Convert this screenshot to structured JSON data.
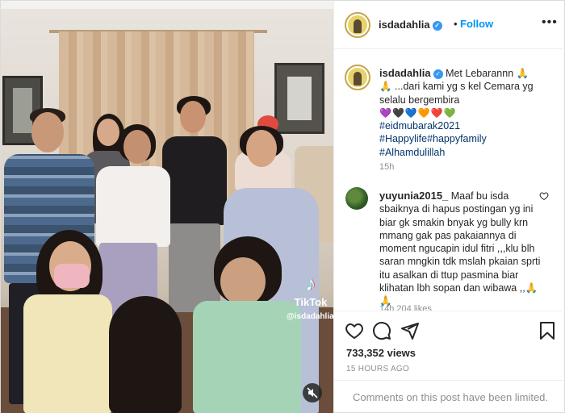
{
  "media": {
    "watermark_brand": "TikTok",
    "watermark_handle": "@isdadahlia"
  },
  "header": {
    "username": "isdadahlia",
    "separator": "•",
    "follow_label": "Follow",
    "more_label": "•••"
  },
  "caption": {
    "username": "isdadahlia",
    "text_line1": "Met Lebarannn 🙏",
    "text_line2": "🙏 ...dari kami yg s kel Cemara yg selalu bergembira",
    "hearts": "💜🖤💙🧡❤️💚",
    "hashtags": [
      "#eidmubarak2021",
      "#Happylife#happyfamily",
      "#Alhamdulillah"
    ],
    "time": "15h"
  },
  "comment": {
    "username": "yuyunia2015_",
    "text": "Maaf bu isda sbaiknya di hapus postingan yg ini biar gk smakin bnyak yg bully krn mmang gak pas pakaiannya di moment ngucapin idul fitri ,,,klu blh saran mngkin tdk mslah pkaian sprti itu asalkan di ttup pasmina biar klihatan lbh sopan dan wibawa ,,🙏🙏",
    "meta": "14h  204 likes"
  },
  "actions": {
    "views": "733,352 views",
    "time_ago": "15 HOURS AGO"
  },
  "footer": {
    "limited_text": "Comments on this post have been limited."
  },
  "colors": {
    "link": "#0095f6",
    "hashtag": "#00376b",
    "muted": "#8e8e8e",
    "verified": "#3897f0"
  },
  "icons": [
    "verified-badge-icon",
    "more-options-icon",
    "heart-icon",
    "comment-icon",
    "share-icon",
    "bookmark-icon",
    "mute-icon",
    "tiktok-logo-icon"
  ]
}
